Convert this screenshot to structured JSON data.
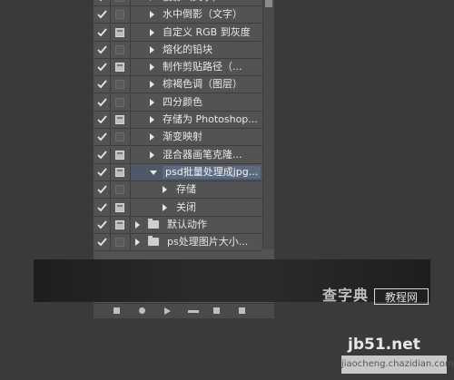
{
  "actions_panel": {
    "rows": [
      {
        "label": "投影（文字）",
        "type": "action",
        "dialog": false,
        "selected": false
      },
      {
        "label": "水中倒影（文字）",
        "type": "action",
        "dialog": false,
        "selected": false
      },
      {
        "label": "自定义 RGB 到灰度",
        "type": "action",
        "dialog": true,
        "selected": false
      },
      {
        "label": "熔化的铅块",
        "type": "action",
        "dialog": false,
        "selected": false
      },
      {
        "label": "制作剪贴路径（...",
        "type": "action",
        "dialog": true,
        "selected": false
      },
      {
        "label": "棕褐色调（图层）",
        "type": "action",
        "dialog": false,
        "selected": false
      },
      {
        "label": "四分颜色",
        "type": "action",
        "dialog": false,
        "selected": false
      },
      {
        "label": "存储为 Photoshop...",
        "type": "action",
        "dialog": true,
        "selected": false
      },
      {
        "label": "渐变映射",
        "type": "action",
        "dialog": false,
        "selected": false
      },
      {
        "label": "混合器画笔克隆...",
        "type": "action",
        "dialog": true,
        "selected": false
      },
      {
        "label": "psd批量处理成jpg...",
        "type": "action-expanded",
        "dialog": true,
        "selected": true
      },
      {
        "label": "存储",
        "type": "step",
        "dialog": false,
        "selected": false
      },
      {
        "label": "关闭",
        "type": "step",
        "dialog": true,
        "selected": false
      },
      {
        "label": "默认动作",
        "type": "set",
        "dialog": true,
        "selected": false
      },
      {
        "label": "ps处理图片大小...",
        "type": "set",
        "dialog": false,
        "selected": false
      }
    ]
  },
  "watermark": {
    "site_text": "查字典",
    "tutorial_text": "教程网",
    "url_text": "jb51.net",
    "sub_text": "jiaocheng.chazidian.com"
  },
  "colors": {
    "panel_bg": "#535353",
    "selected_bg": "#5d6b80",
    "page_bg": "#3a3a3a"
  }
}
